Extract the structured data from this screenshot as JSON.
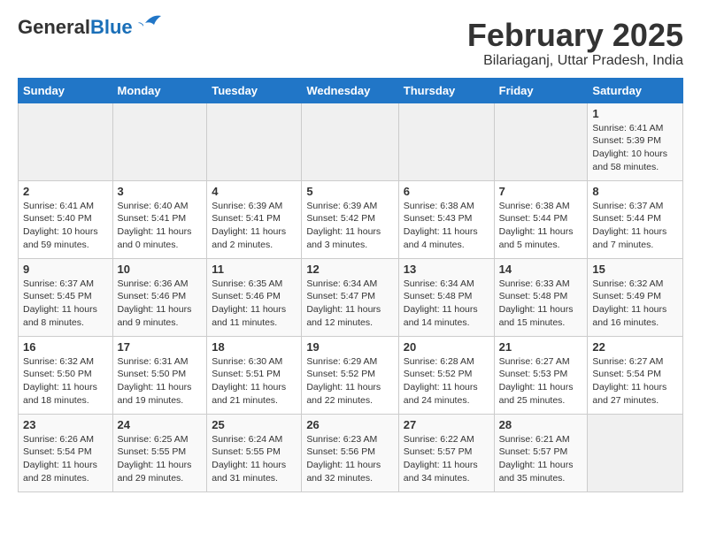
{
  "logo": {
    "line1": "General",
    "line2": "Blue"
  },
  "title": "February 2025",
  "subtitle": "Bilariaganj, Uttar Pradesh, India",
  "days_of_week": [
    "Sunday",
    "Monday",
    "Tuesday",
    "Wednesday",
    "Thursday",
    "Friday",
    "Saturday"
  ],
  "weeks": [
    [
      {
        "day": "",
        "info": ""
      },
      {
        "day": "",
        "info": ""
      },
      {
        "day": "",
        "info": ""
      },
      {
        "day": "",
        "info": ""
      },
      {
        "day": "",
        "info": ""
      },
      {
        "day": "",
        "info": ""
      },
      {
        "day": "1",
        "info": "Sunrise: 6:41 AM\nSunset: 5:39 PM\nDaylight: 10 hours\nand 58 minutes."
      }
    ],
    [
      {
        "day": "2",
        "info": "Sunrise: 6:41 AM\nSunset: 5:40 PM\nDaylight: 10 hours\nand 59 minutes."
      },
      {
        "day": "3",
        "info": "Sunrise: 6:40 AM\nSunset: 5:41 PM\nDaylight: 11 hours\nand 0 minutes."
      },
      {
        "day": "4",
        "info": "Sunrise: 6:39 AM\nSunset: 5:41 PM\nDaylight: 11 hours\nand 2 minutes."
      },
      {
        "day": "5",
        "info": "Sunrise: 6:39 AM\nSunset: 5:42 PM\nDaylight: 11 hours\nand 3 minutes."
      },
      {
        "day": "6",
        "info": "Sunrise: 6:38 AM\nSunset: 5:43 PM\nDaylight: 11 hours\nand 4 minutes."
      },
      {
        "day": "7",
        "info": "Sunrise: 6:38 AM\nSunset: 5:44 PM\nDaylight: 11 hours\nand 5 minutes."
      },
      {
        "day": "8",
        "info": "Sunrise: 6:37 AM\nSunset: 5:44 PM\nDaylight: 11 hours\nand 7 minutes."
      }
    ],
    [
      {
        "day": "9",
        "info": "Sunrise: 6:37 AM\nSunset: 5:45 PM\nDaylight: 11 hours\nand 8 minutes."
      },
      {
        "day": "10",
        "info": "Sunrise: 6:36 AM\nSunset: 5:46 PM\nDaylight: 11 hours\nand 9 minutes."
      },
      {
        "day": "11",
        "info": "Sunrise: 6:35 AM\nSunset: 5:46 PM\nDaylight: 11 hours\nand 11 minutes."
      },
      {
        "day": "12",
        "info": "Sunrise: 6:34 AM\nSunset: 5:47 PM\nDaylight: 11 hours\nand 12 minutes."
      },
      {
        "day": "13",
        "info": "Sunrise: 6:34 AM\nSunset: 5:48 PM\nDaylight: 11 hours\nand 14 minutes."
      },
      {
        "day": "14",
        "info": "Sunrise: 6:33 AM\nSunset: 5:48 PM\nDaylight: 11 hours\nand 15 minutes."
      },
      {
        "day": "15",
        "info": "Sunrise: 6:32 AM\nSunset: 5:49 PM\nDaylight: 11 hours\nand 16 minutes."
      }
    ],
    [
      {
        "day": "16",
        "info": "Sunrise: 6:32 AM\nSunset: 5:50 PM\nDaylight: 11 hours\nand 18 minutes."
      },
      {
        "day": "17",
        "info": "Sunrise: 6:31 AM\nSunset: 5:50 PM\nDaylight: 11 hours\nand 19 minutes."
      },
      {
        "day": "18",
        "info": "Sunrise: 6:30 AM\nSunset: 5:51 PM\nDaylight: 11 hours\nand 21 minutes."
      },
      {
        "day": "19",
        "info": "Sunrise: 6:29 AM\nSunset: 5:52 PM\nDaylight: 11 hours\nand 22 minutes."
      },
      {
        "day": "20",
        "info": "Sunrise: 6:28 AM\nSunset: 5:52 PM\nDaylight: 11 hours\nand 24 minutes."
      },
      {
        "day": "21",
        "info": "Sunrise: 6:27 AM\nSunset: 5:53 PM\nDaylight: 11 hours\nand 25 minutes."
      },
      {
        "day": "22",
        "info": "Sunrise: 6:27 AM\nSunset: 5:54 PM\nDaylight: 11 hours\nand 27 minutes."
      }
    ],
    [
      {
        "day": "23",
        "info": "Sunrise: 6:26 AM\nSunset: 5:54 PM\nDaylight: 11 hours\nand 28 minutes."
      },
      {
        "day": "24",
        "info": "Sunrise: 6:25 AM\nSunset: 5:55 PM\nDaylight: 11 hours\nand 29 minutes."
      },
      {
        "day": "25",
        "info": "Sunrise: 6:24 AM\nSunset: 5:55 PM\nDaylight: 11 hours\nand 31 minutes."
      },
      {
        "day": "26",
        "info": "Sunrise: 6:23 AM\nSunset: 5:56 PM\nDaylight: 11 hours\nand 32 minutes."
      },
      {
        "day": "27",
        "info": "Sunrise: 6:22 AM\nSunset: 5:57 PM\nDaylight: 11 hours\nand 34 minutes."
      },
      {
        "day": "28",
        "info": "Sunrise: 6:21 AM\nSunset: 5:57 PM\nDaylight: 11 hours\nand 35 minutes."
      },
      {
        "day": "",
        "info": ""
      }
    ]
  ]
}
